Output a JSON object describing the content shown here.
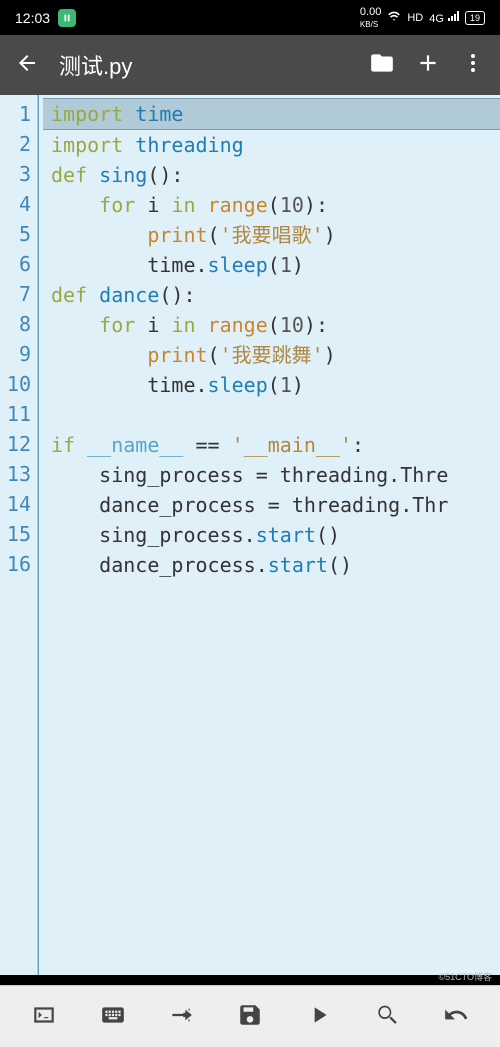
{
  "status": {
    "time": "12:03",
    "kbs": "0.00",
    "kbs_label": "KB/S",
    "hd": "HD",
    "net": "4G",
    "battery": "19"
  },
  "appbar": {
    "title": "测试.py"
  },
  "code": {
    "lines": [
      {
        "n": "1",
        "highlighted": true,
        "tokens": [
          {
            "t": "import ",
            "c": "tok-keyword"
          },
          {
            "t": "time",
            "c": "tok-module"
          }
        ]
      },
      {
        "n": "2",
        "tokens": [
          {
            "t": "import ",
            "c": "tok-keyword"
          },
          {
            "t": "threading",
            "c": "tok-module"
          }
        ]
      },
      {
        "n": "3",
        "tokens": [
          {
            "t": "def ",
            "c": "tok-keyword"
          },
          {
            "t": "sing",
            "c": "tok-def"
          },
          {
            "t": "():",
            "c": "tok-punc"
          }
        ]
      },
      {
        "n": "4",
        "tokens": [
          {
            "t": "    ",
            "c": ""
          },
          {
            "t": "for ",
            "c": "tok-keyword"
          },
          {
            "t": "i ",
            "c": "tok-ident"
          },
          {
            "t": "in ",
            "c": "tok-keyword"
          },
          {
            "t": "range",
            "c": "tok-builtin"
          },
          {
            "t": "(",
            "c": "tok-punc"
          },
          {
            "t": "10",
            "c": "tok-num"
          },
          {
            "t": "):",
            "c": "tok-punc"
          }
        ]
      },
      {
        "n": "5",
        "tokens": [
          {
            "t": "        ",
            "c": ""
          },
          {
            "t": "print",
            "c": "tok-builtin"
          },
          {
            "t": "(",
            "c": "tok-punc"
          },
          {
            "t": "'我要唱歌'",
            "c": "tok-string"
          },
          {
            "t": ")",
            "c": "tok-punc"
          }
        ]
      },
      {
        "n": "6",
        "tokens": [
          {
            "t": "        ",
            "c": ""
          },
          {
            "t": "time",
            "c": "tok-ident"
          },
          {
            "t": ".",
            "c": "tok-punc"
          },
          {
            "t": "sleep",
            "c": "tok-attr"
          },
          {
            "t": "(",
            "c": "tok-punc"
          },
          {
            "t": "1",
            "c": "tok-num"
          },
          {
            "t": ")",
            "c": "tok-punc"
          }
        ]
      },
      {
        "n": "7",
        "tokens": [
          {
            "t": "def ",
            "c": "tok-keyword"
          },
          {
            "t": "dance",
            "c": "tok-def"
          },
          {
            "t": "():",
            "c": "tok-punc"
          }
        ]
      },
      {
        "n": "8",
        "tokens": [
          {
            "t": "    ",
            "c": ""
          },
          {
            "t": "for ",
            "c": "tok-keyword"
          },
          {
            "t": "i ",
            "c": "tok-ident"
          },
          {
            "t": "in ",
            "c": "tok-keyword"
          },
          {
            "t": "range",
            "c": "tok-builtin"
          },
          {
            "t": "(",
            "c": "tok-punc"
          },
          {
            "t": "10",
            "c": "tok-num"
          },
          {
            "t": "):",
            "c": "tok-punc"
          }
        ]
      },
      {
        "n": "9",
        "tokens": [
          {
            "t": "        ",
            "c": ""
          },
          {
            "t": "print",
            "c": "tok-builtin"
          },
          {
            "t": "(",
            "c": "tok-punc"
          },
          {
            "t": "'我要跳舞'",
            "c": "tok-string"
          },
          {
            "t": ")",
            "c": "tok-punc"
          }
        ]
      },
      {
        "n": "10",
        "tokens": [
          {
            "t": "        ",
            "c": ""
          },
          {
            "t": "time",
            "c": "tok-ident"
          },
          {
            "t": ".",
            "c": "tok-punc"
          },
          {
            "t": "sleep",
            "c": "tok-attr"
          },
          {
            "t": "(",
            "c": "tok-punc"
          },
          {
            "t": "1",
            "c": "tok-num"
          },
          {
            "t": ")",
            "c": "tok-punc"
          }
        ]
      },
      {
        "n": "11",
        "tokens": []
      },
      {
        "n": "12",
        "tokens": [
          {
            "t": "if ",
            "c": "tok-keyword"
          },
          {
            "t": "__name__",
            "c": "tok-dunder"
          },
          {
            "t": " == ",
            "c": "tok-punc"
          },
          {
            "t": "'__main__'",
            "c": "tok-string"
          },
          {
            "t": ":",
            "c": "tok-punc"
          }
        ]
      },
      {
        "n": "13",
        "tokens": [
          {
            "t": "    ",
            "c": ""
          },
          {
            "t": "sing_process = threading.Thre",
            "c": "tok-ident"
          }
        ]
      },
      {
        "n": "14",
        "tokens": [
          {
            "t": "    ",
            "c": ""
          },
          {
            "t": "dance_process = threading.Thr",
            "c": "tok-ident"
          }
        ]
      },
      {
        "n": "15",
        "tokens": [
          {
            "t": "    ",
            "c": ""
          },
          {
            "t": "sing_process",
            "c": "tok-ident"
          },
          {
            "t": ".",
            "c": "tok-punc"
          },
          {
            "t": "start",
            "c": "tok-attr"
          },
          {
            "t": "()",
            "c": "tok-punc"
          }
        ]
      },
      {
        "n": "16",
        "tokens": [
          {
            "t": "    ",
            "c": ""
          },
          {
            "t": "dance_process",
            "c": "tok-ident"
          },
          {
            "t": ".",
            "c": "tok-punc"
          },
          {
            "t": "start",
            "c": "tok-attr"
          },
          {
            "t": "()",
            "c": "tok-punc"
          }
        ]
      }
    ]
  },
  "watermark": "©51CTO博客"
}
